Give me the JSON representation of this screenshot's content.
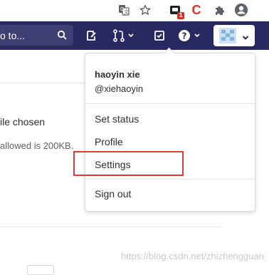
{
  "browser_toolbar": {
    "icons": [
      "translate-icon",
      "bookmark-star-icon",
      "extension-badge-icon",
      "csdn-c-icon",
      "extensions-puzzle-icon",
      "profile-account-icon"
    ],
    "extension_badge_count": "1",
    "csdn_letter": "C",
    "accent_red": "#d93025"
  },
  "navbar": {
    "background": "#292961",
    "search_placeholder": "o to...",
    "icons": [
      "search-icon",
      "todo-icon",
      "merge-request-icon",
      "issues-icon",
      "help-icon",
      "avatar"
    ]
  },
  "page": {
    "file_status": "ile chosen",
    "size_hint": "allowed is 200KB."
  },
  "user_menu": {
    "name": "haoyin xie",
    "username": "@xiehaoyin",
    "items": [
      {
        "label": "Set status"
      },
      {
        "label": "Profile"
      },
      {
        "label": "Settings",
        "highlighted": true
      },
      {
        "label": "Sign out"
      }
    ]
  },
  "watermark": "https://blog.csdn.net/zhizhengguan"
}
